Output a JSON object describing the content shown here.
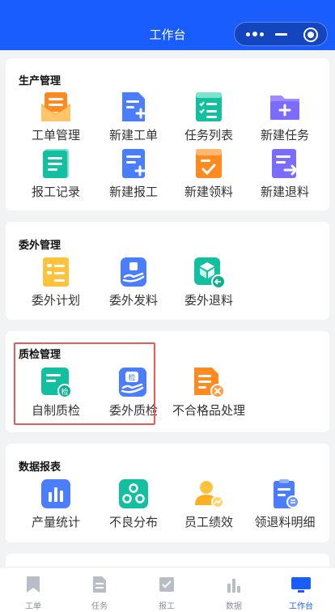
{
  "header": {
    "title": "工作台"
  },
  "sections": {
    "production": {
      "title": "生产管理",
      "items": [
        {
          "label": "工单管理",
          "icon": "envelope-list-icon"
        },
        {
          "label": "新建工单",
          "icon": "doc-add-icon"
        },
        {
          "label": "任务列表",
          "icon": "checklist-icon"
        },
        {
          "label": "新建任务",
          "icon": "folder-add-icon"
        },
        {
          "label": "报工记录",
          "icon": "report-record-icon"
        },
        {
          "label": "新建报工",
          "icon": "report-add-icon"
        },
        {
          "label": "新建领料",
          "icon": "material-check-icon"
        },
        {
          "label": "新建退料",
          "icon": "material-return-icon"
        }
      ]
    },
    "outsourcing": {
      "title": "委外管理",
      "items": [
        {
          "label": "委外计划",
          "icon": "outsource-plan-icon"
        },
        {
          "label": "委外发料",
          "icon": "outsource-send-icon"
        },
        {
          "label": "委外退料",
          "icon": "outsource-return-icon"
        }
      ]
    },
    "quality": {
      "title": "质检管理",
      "badge_text": "检",
      "items": [
        {
          "label": "自制质检",
          "icon": "self-inspect-icon"
        },
        {
          "label": "委外质检",
          "icon": "outsource-inspect-icon"
        },
        {
          "label": "不合格品处理",
          "icon": "defect-handle-icon"
        }
      ]
    },
    "reports": {
      "title": "数据报表",
      "items": [
        {
          "label": "产量统计",
          "icon": "bar-chart-icon"
        },
        {
          "label": "不良分布",
          "icon": "distribution-icon"
        },
        {
          "label": "员工绩效",
          "icon": "employee-performance-icon"
        },
        {
          "label": "领退料明细",
          "icon": "material-detail-icon"
        }
      ]
    }
  },
  "bottom_nav": [
    {
      "label": "工单",
      "icon": "bookmark-icon",
      "active": false
    },
    {
      "label": "任务",
      "icon": "document-icon",
      "active": false
    },
    {
      "label": "报工",
      "icon": "checkbox-icon",
      "active": false
    },
    {
      "label": "数据",
      "icon": "bar-chart-icon",
      "active": false
    },
    {
      "label": "工作台",
      "icon": "monitor-icon",
      "active": true
    }
  ],
  "colors": {
    "primary": "#1a5dff",
    "highlight_border": "#e85a58",
    "orange": "#ff8a1f",
    "blue": "#4a7dff",
    "teal": "#12c0a0",
    "purple": "#7b6cff",
    "yellow": "#ffc23d",
    "nav_inactive": "#8a8f99"
  }
}
